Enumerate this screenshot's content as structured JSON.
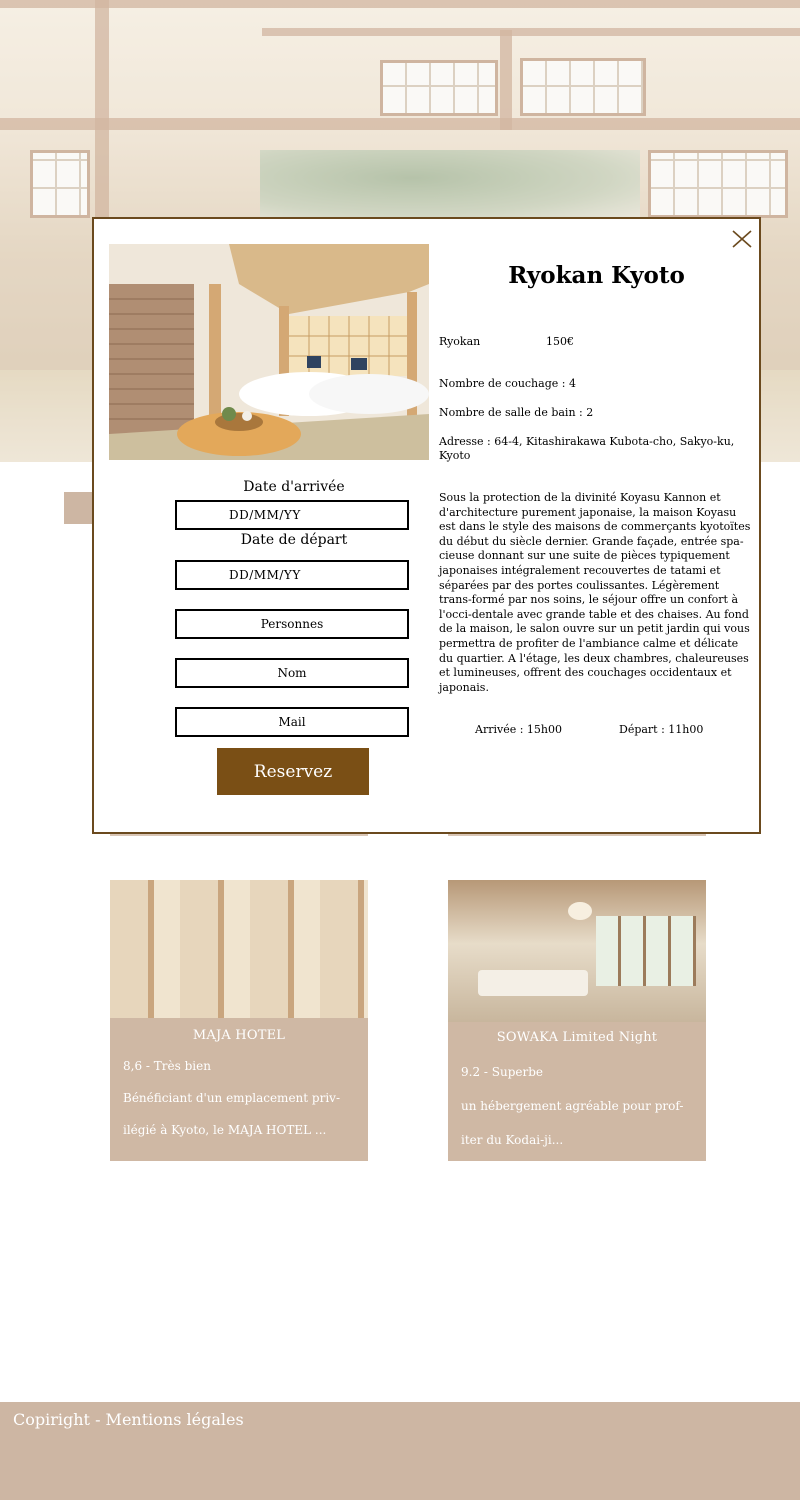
{
  "background": {
    "card_1": {
      "name": "MAJA HOTEL",
      "rating": "8,6 - Très bien",
      "excerpt_line1": "Bénéficiant d'un emplacement priv-",
      "excerpt_line2": "ilégié à Kyoto, le MAJA HOTEL ..."
    },
    "card_2": {
      "name": "SOWAKA Limited Night",
      "rating": "9.2 - Superbe",
      "excerpt_line1": "un hébergement agréable pour prof-",
      "excerpt_line2": "iter du Kodai-ji..."
    },
    "footer": {
      "text": "Copiright - Mentions légales"
    }
  },
  "modal": {
    "title": "Ryokan Kyoto",
    "close_icon": "close-x-icon",
    "type": "Ryokan",
    "price": "150€",
    "beds": "Nombre de couchage : 4",
    "bathrooms": "Nombre de salle de bain : 2",
    "address": "Adresse : 64-4, Kitashirakawa Kubota-cho, Sakyo-ku, Kyoto",
    "description": "Sous la protection de la divinité Koyasu Kannon et d'architecture purement japonaise, la maison Koyasu est dans le style des maisons de commerçants kyotoïtes du début du siècle dernier. Grande façade, entrée spa-cieuse donnant sur une suite de pièces typiquement japonaises intégralement recouvertes de tatami et séparées par des portes coulissantes. Légèrement trans-formé par nos soins, le séjour offre un confort à l'occi-dentale avec grande table et des chaises. Au fond de la maison, le salon ouvre sur un petit jardin qui vous permettra de profiter de l'ambiance calme et délicate du quartier. A l'étage, les deux chambres, chaleureuses et lumineuses, offrent des couchages occidentaux et japonais.",
    "checkin": "Arrivée : 15h00",
    "checkout": "Départ : 11h00",
    "form": {
      "arrival_label": "Date d'arrivée",
      "arrival_placeholder": "DD/MM/YY",
      "departure_label": "Date de départ",
      "departure_placeholder": "DD/MM/YY",
      "persons_placeholder": "Personnes",
      "name_placeholder": "Nom",
      "mail_placeholder": "Mail",
      "submit_label": "Reservez"
    }
  },
  "colors": {
    "accent_brown": "#7a4f15",
    "modal_border": "#6b4a1e",
    "card_beige": "#cfb8a4",
    "footer_beige": "#cdb6a3"
  }
}
